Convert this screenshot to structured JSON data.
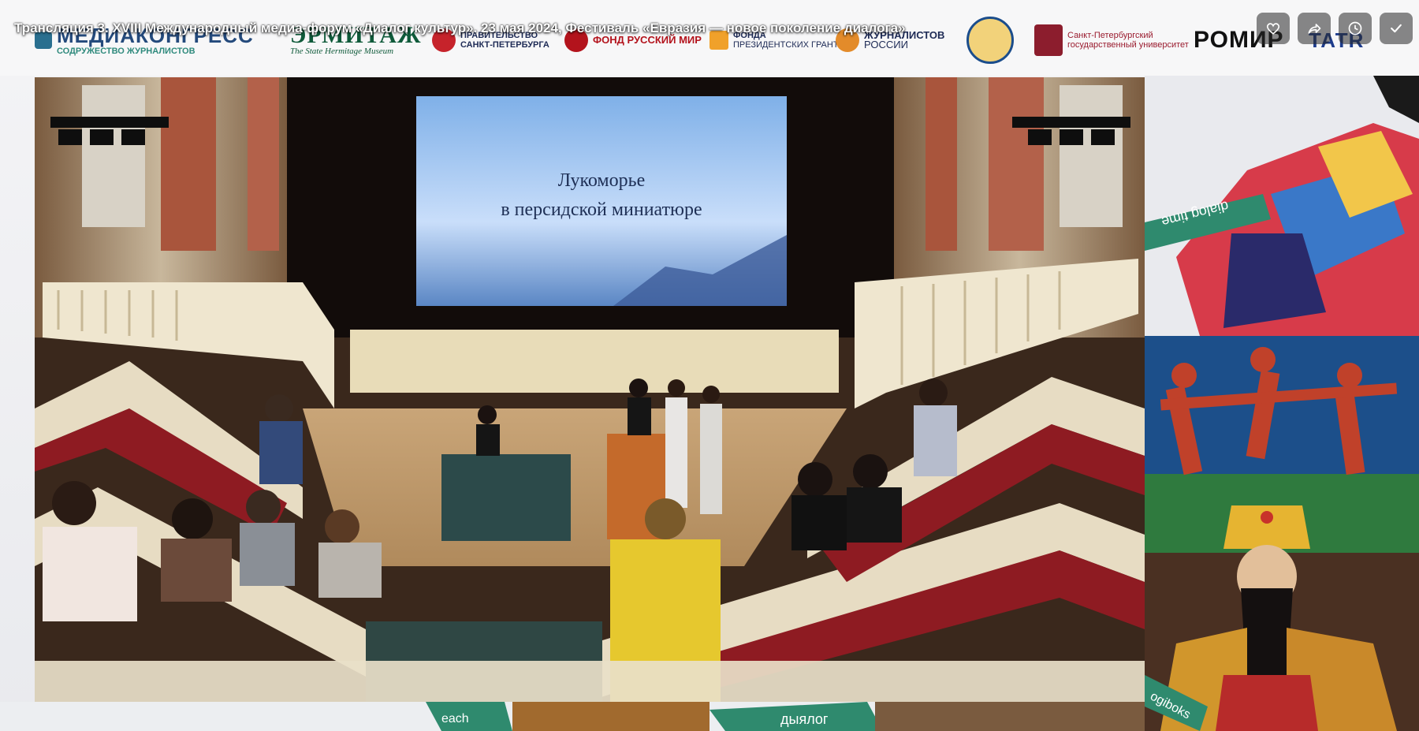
{
  "video": {
    "title": "Трансляция 3. XVIII Международный медиа-форум «Диалог культур». 23 мая 2024, Фестиваль «Евразия — новое поколение диалога»"
  },
  "actions": [
    {
      "icon": "heart-icon",
      "label": "Like"
    },
    {
      "icon": "share-icon",
      "label": "Share"
    },
    {
      "icon": "clock-icon",
      "label": "Watch later"
    },
    {
      "icon": "check-icon",
      "label": "Done"
    }
  ],
  "sponsors": [
    {
      "name": "МЕДИАКОНГРЕСС",
      "sub": "СОДРУЖЕСТВО ЖУРНАЛИСТОВ"
    },
    {
      "name": "ЭРМИТАЖ",
      "sub": "The State Hermitage Museum"
    },
    {
      "name": "ПРАВИТЕЛЬСТВО",
      "sub": "САНКТ-ПЕТЕРБУРГА"
    },
    {
      "name": "ФОНД РУССКИЙ МИР",
      "sub": ""
    },
    {
      "name": "ФОНДА",
      "sub": "ПРЕЗИДЕНТСКИХ ГРАНТОВ"
    },
    {
      "name": "ЖУРНАЛИСТОВ",
      "sub": "РОССИИ"
    },
    {
      "name": "Санкт-Петербургский",
      "sub": "государственный университет"
    },
    {
      "name": "РОМИР",
      "sub": ""
    },
    {
      "name": "ТАТR",
      "sub": ""
    }
  ],
  "screen_text": {
    "line1": "Лукоморье",
    "line2": "в персидской миниатюре"
  },
  "deco_text": {
    "top_ribbon": "dialog time",
    "bottom_ribbon": "ogiboks",
    "bottom_strip_1": "each",
    "bottom_strip_2": "дыялог"
  }
}
